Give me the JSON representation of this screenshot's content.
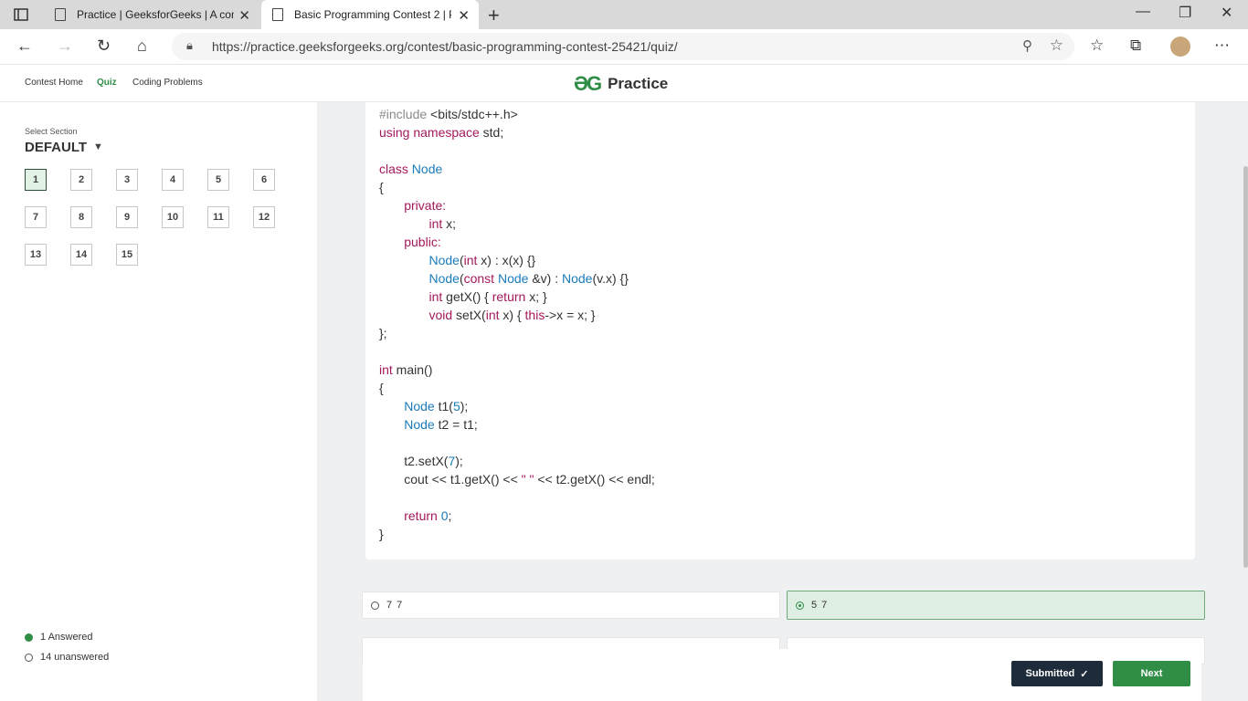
{
  "browser": {
    "tabs": [
      {
        "title": "Practice | GeeksforGeeks | A com",
        "active": false
      },
      {
        "title": "Basic Programming Contest 2 | P",
        "active": true
      }
    ],
    "url": "https://practice.geeksforgeeks.org/contest/basic-programming-contest-25421/quiz/"
  },
  "header": {
    "nav": [
      "Contest Home",
      "Quiz",
      "Coding Problems"
    ],
    "active_nav": "Quiz",
    "brand": "Practice"
  },
  "sidebar": {
    "section_label": "Select Section",
    "section_value": "DEFAULT",
    "questions": [
      "1",
      "2",
      "3",
      "4",
      "5",
      "6",
      "7",
      "8",
      "9",
      "10",
      "11",
      "12",
      "13",
      "14",
      "15"
    ],
    "current_question": "1",
    "answered": "1 Answered",
    "unanswered": "14 unanswered"
  },
  "options": [
    "7 7",
    "5 7"
  ],
  "selected_option": "5 7",
  "footer": {
    "submitted": "Submitted",
    "next": "Next"
  },
  "colors": {
    "accent": "#2f8d46",
    "dark_button": "#1d2b3a",
    "keyword": "#a3195b",
    "type": "#1a7bb9"
  }
}
